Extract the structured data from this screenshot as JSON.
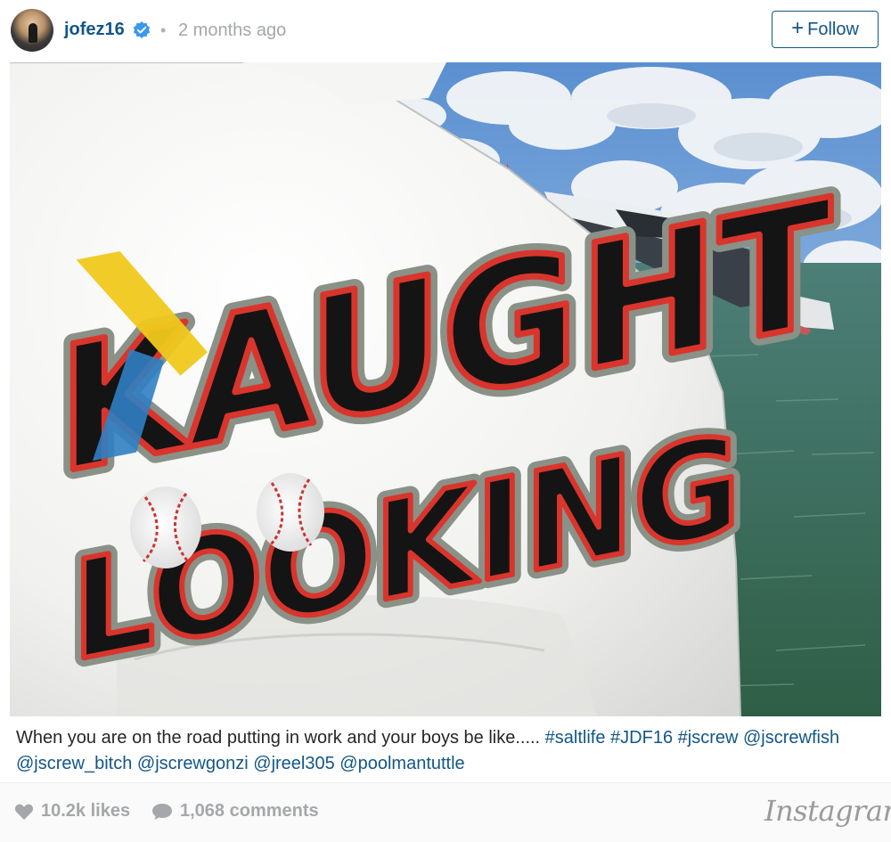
{
  "post": {
    "username": "jofez16",
    "separator": "•",
    "time_ago": "2 months ago",
    "follow_label": "Follow",
    "follow_plus": "+",
    "photo": {
      "line1": "KAUGHT",
      "line2": "LOOKING"
    },
    "caption": {
      "text": "When you are on the road putting in work and your boys be like..... ",
      "tags": [
        "#saltlife",
        "#JDF16",
        "#jscrew",
        "@jscrewfish",
        "@jscrew_bitch",
        "@jscrewgonzi",
        "@jreel305",
        "@poolmantuttle"
      ]
    },
    "likes": "10.2k likes",
    "comments": "1,068 comments",
    "brand": "Instagram"
  },
  "colors": {
    "link": "#125688",
    "muted": "#a5a7aa",
    "footer_bg": "#fafafa"
  },
  "icons": {
    "verified": "verified-badge-icon",
    "like": "heart-icon",
    "comment": "speech-bubble-icon"
  }
}
